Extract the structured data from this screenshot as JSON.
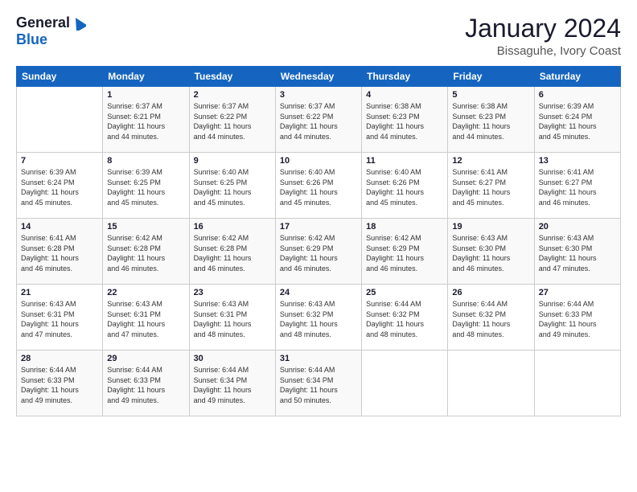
{
  "header": {
    "logo_general": "General",
    "logo_blue": "Blue",
    "month": "January 2024",
    "location": "Bissaguhe, Ivory Coast"
  },
  "weekdays": [
    "Sunday",
    "Monday",
    "Tuesday",
    "Wednesday",
    "Thursday",
    "Friday",
    "Saturday"
  ],
  "weeks": [
    [
      {
        "day": "",
        "info": ""
      },
      {
        "day": "1",
        "info": "Sunrise: 6:37 AM\nSunset: 6:21 PM\nDaylight: 11 hours\nand 44 minutes."
      },
      {
        "day": "2",
        "info": "Sunrise: 6:37 AM\nSunset: 6:22 PM\nDaylight: 11 hours\nand 44 minutes."
      },
      {
        "day": "3",
        "info": "Sunrise: 6:37 AM\nSunset: 6:22 PM\nDaylight: 11 hours\nand 44 minutes."
      },
      {
        "day": "4",
        "info": "Sunrise: 6:38 AM\nSunset: 6:23 PM\nDaylight: 11 hours\nand 44 minutes."
      },
      {
        "day": "5",
        "info": "Sunrise: 6:38 AM\nSunset: 6:23 PM\nDaylight: 11 hours\nand 44 minutes."
      },
      {
        "day": "6",
        "info": "Sunrise: 6:39 AM\nSunset: 6:24 PM\nDaylight: 11 hours\nand 45 minutes."
      }
    ],
    [
      {
        "day": "7",
        "info": "Sunrise: 6:39 AM\nSunset: 6:24 PM\nDaylight: 11 hours\nand 45 minutes."
      },
      {
        "day": "8",
        "info": "Sunrise: 6:39 AM\nSunset: 6:25 PM\nDaylight: 11 hours\nand 45 minutes."
      },
      {
        "day": "9",
        "info": "Sunrise: 6:40 AM\nSunset: 6:25 PM\nDaylight: 11 hours\nand 45 minutes."
      },
      {
        "day": "10",
        "info": "Sunrise: 6:40 AM\nSunset: 6:26 PM\nDaylight: 11 hours\nand 45 minutes."
      },
      {
        "day": "11",
        "info": "Sunrise: 6:40 AM\nSunset: 6:26 PM\nDaylight: 11 hours\nand 45 minutes."
      },
      {
        "day": "12",
        "info": "Sunrise: 6:41 AM\nSunset: 6:27 PM\nDaylight: 11 hours\nand 45 minutes."
      },
      {
        "day": "13",
        "info": "Sunrise: 6:41 AM\nSunset: 6:27 PM\nDaylight: 11 hours\nand 46 minutes."
      }
    ],
    [
      {
        "day": "14",
        "info": "Sunrise: 6:41 AM\nSunset: 6:28 PM\nDaylight: 11 hours\nand 46 minutes."
      },
      {
        "day": "15",
        "info": "Sunrise: 6:42 AM\nSunset: 6:28 PM\nDaylight: 11 hours\nand 46 minutes."
      },
      {
        "day": "16",
        "info": "Sunrise: 6:42 AM\nSunset: 6:28 PM\nDaylight: 11 hours\nand 46 minutes."
      },
      {
        "day": "17",
        "info": "Sunrise: 6:42 AM\nSunset: 6:29 PM\nDaylight: 11 hours\nand 46 minutes."
      },
      {
        "day": "18",
        "info": "Sunrise: 6:42 AM\nSunset: 6:29 PM\nDaylight: 11 hours\nand 46 minutes."
      },
      {
        "day": "19",
        "info": "Sunrise: 6:43 AM\nSunset: 6:30 PM\nDaylight: 11 hours\nand 46 minutes."
      },
      {
        "day": "20",
        "info": "Sunrise: 6:43 AM\nSunset: 6:30 PM\nDaylight: 11 hours\nand 47 minutes."
      }
    ],
    [
      {
        "day": "21",
        "info": "Sunrise: 6:43 AM\nSunset: 6:31 PM\nDaylight: 11 hours\nand 47 minutes."
      },
      {
        "day": "22",
        "info": "Sunrise: 6:43 AM\nSunset: 6:31 PM\nDaylight: 11 hours\nand 47 minutes."
      },
      {
        "day": "23",
        "info": "Sunrise: 6:43 AM\nSunset: 6:31 PM\nDaylight: 11 hours\nand 48 minutes."
      },
      {
        "day": "24",
        "info": "Sunrise: 6:43 AM\nSunset: 6:32 PM\nDaylight: 11 hours\nand 48 minutes."
      },
      {
        "day": "25",
        "info": "Sunrise: 6:44 AM\nSunset: 6:32 PM\nDaylight: 11 hours\nand 48 minutes."
      },
      {
        "day": "26",
        "info": "Sunrise: 6:44 AM\nSunset: 6:32 PM\nDaylight: 11 hours\nand 48 minutes."
      },
      {
        "day": "27",
        "info": "Sunrise: 6:44 AM\nSunset: 6:33 PM\nDaylight: 11 hours\nand 49 minutes."
      }
    ],
    [
      {
        "day": "28",
        "info": "Sunrise: 6:44 AM\nSunset: 6:33 PM\nDaylight: 11 hours\nand 49 minutes."
      },
      {
        "day": "29",
        "info": "Sunrise: 6:44 AM\nSunset: 6:33 PM\nDaylight: 11 hours\nand 49 minutes."
      },
      {
        "day": "30",
        "info": "Sunrise: 6:44 AM\nSunset: 6:34 PM\nDaylight: 11 hours\nand 49 minutes."
      },
      {
        "day": "31",
        "info": "Sunrise: 6:44 AM\nSunset: 6:34 PM\nDaylight: 11 hours\nand 50 minutes."
      },
      {
        "day": "",
        "info": ""
      },
      {
        "day": "",
        "info": ""
      },
      {
        "day": "",
        "info": ""
      }
    ]
  ]
}
